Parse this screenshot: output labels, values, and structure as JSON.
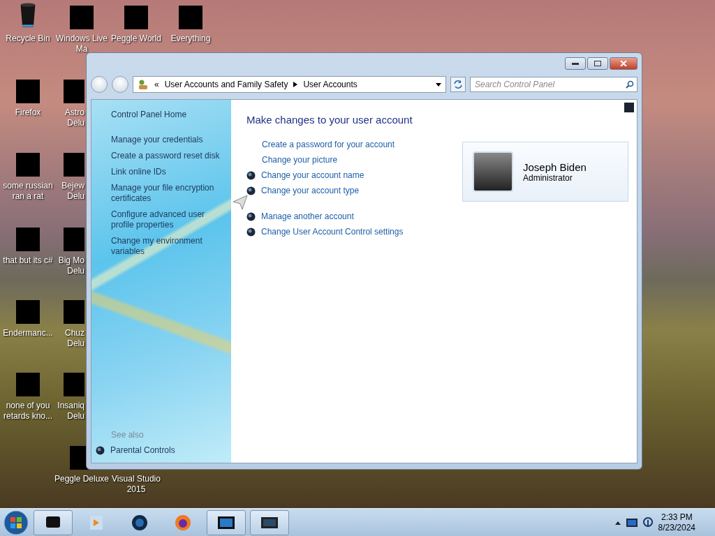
{
  "desktop_icons": [
    {
      "kind": "recycle",
      "lines": [
        "Recycle Bin"
      ]
    },
    {
      "kind": "covered",
      "lines": [
        "Windows Live",
        "Ma"
      ]
    },
    {
      "kind": "covered",
      "lines": [
        "Peggle World"
      ]
    },
    {
      "kind": "covered",
      "lines": [
        "Everything"
      ]
    },
    {
      "kind": "covered",
      "lines": [
        "Firefox"
      ]
    },
    {
      "kind": "covered",
      "lines": [
        "Astro",
        "Delu"
      ]
    },
    {
      "kind": "covered",
      "lines": [
        "some russian",
        "ran a rat"
      ]
    },
    {
      "kind": "covered",
      "lines": [
        "Bejew",
        "Delu"
      ]
    },
    {
      "kind": "covered",
      "lines": [
        "that but its c#"
      ]
    },
    {
      "kind": "covered",
      "lines": [
        "Big Mo",
        "Delu"
      ]
    },
    {
      "kind": "covered",
      "lines": [
        "Endermanc..."
      ]
    },
    {
      "kind": "covered",
      "lines": [
        "Chuz",
        "Delu"
      ]
    },
    {
      "kind": "covered",
      "lines": [
        "none of you",
        "retards kno..."
      ]
    },
    {
      "kind": "covered",
      "lines": [
        "Insaniq",
        "Delu"
      ]
    },
    {
      "kind": "covered",
      "lines": [
        "Peggle Deluxe"
      ]
    },
    {
      "kind": "plain",
      "lines": [
        "Visual Studio",
        "2015"
      ]
    }
  ],
  "window": {
    "address": {
      "chevron": "«",
      "crumbs": [
        "User Accounts and Family Safety",
        "User Accounts"
      ]
    },
    "search": {
      "placeholder": "Search Control Panel"
    },
    "left_pane": {
      "home": "Control Panel Home",
      "tasks": [
        "Manage your credentials",
        "Create a password reset disk",
        "Link online IDs",
        "Manage your file encryption certificates",
        "Configure advanced user profile properties",
        "Change my environment variables"
      ],
      "see_also_heading": "See also",
      "see_also": [
        {
          "label": "Parental Controls",
          "shield": true
        }
      ]
    },
    "content": {
      "heading": "Make changes to your user account",
      "task_groups": [
        [
          {
            "label": "Create a password for your account",
            "shield": false
          },
          {
            "label": "Change your picture",
            "shield": false
          },
          {
            "label": "Change your account name",
            "shield": true
          },
          {
            "label": "Change your account type",
            "shield": true
          }
        ],
        [
          {
            "label": "Manage another account",
            "shield": true
          },
          {
            "label": "Change User Account Control settings",
            "shield": true
          }
        ]
      ],
      "account": {
        "name": "Joseph Biden",
        "role": "Administrator"
      }
    }
  },
  "taskbar": {
    "buttons": [
      {
        "active": true
      },
      {
        "active": false
      },
      {
        "active": false
      },
      {
        "active": false
      },
      {
        "active": true
      },
      {
        "active": true
      }
    ],
    "clock": {
      "time": "2:33 PM",
      "date": "8/23/2024"
    }
  }
}
